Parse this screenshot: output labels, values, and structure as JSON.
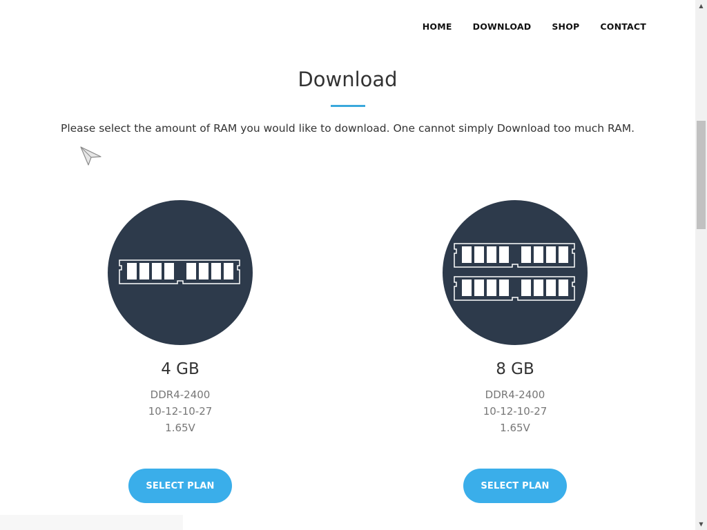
{
  "nav": {
    "items": [
      {
        "label": "HOME"
      },
      {
        "label": "DOWNLOAD"
      },
      {
        "label": "SHOP"
      },
      {
        "label": "CONTACT"
      }
    ]
  },
  "header": {
    "title": "Download",
    "intro": "Please select the amount of RAM you would like to download. One cannot simply Download too much RAM."
  },
  "plans": [
    {
      "icon": "ram-stick-single-icon",
      "size": "4 GB",
      "specs": [
        "DDR4-2400",
        "10-12-10-27",
        "1.65V"
      ],
      "button_label": "SELECT PLAN"
    },
    {
      "icon": "ram-stick-double-icon",
      "size": "8 GB",
      "specs": [
        "DDR4-2400",
        "10-12-10-27",
        "1.65V"
      ],
      "button_label": "SELECT PLAN"
    }
  ],
  "colors": {
    "accent": "#3aaeea",
    "circle": "#2d3a4b",
    "text": "#333333",
    "muted": "#777777"
  }
}
